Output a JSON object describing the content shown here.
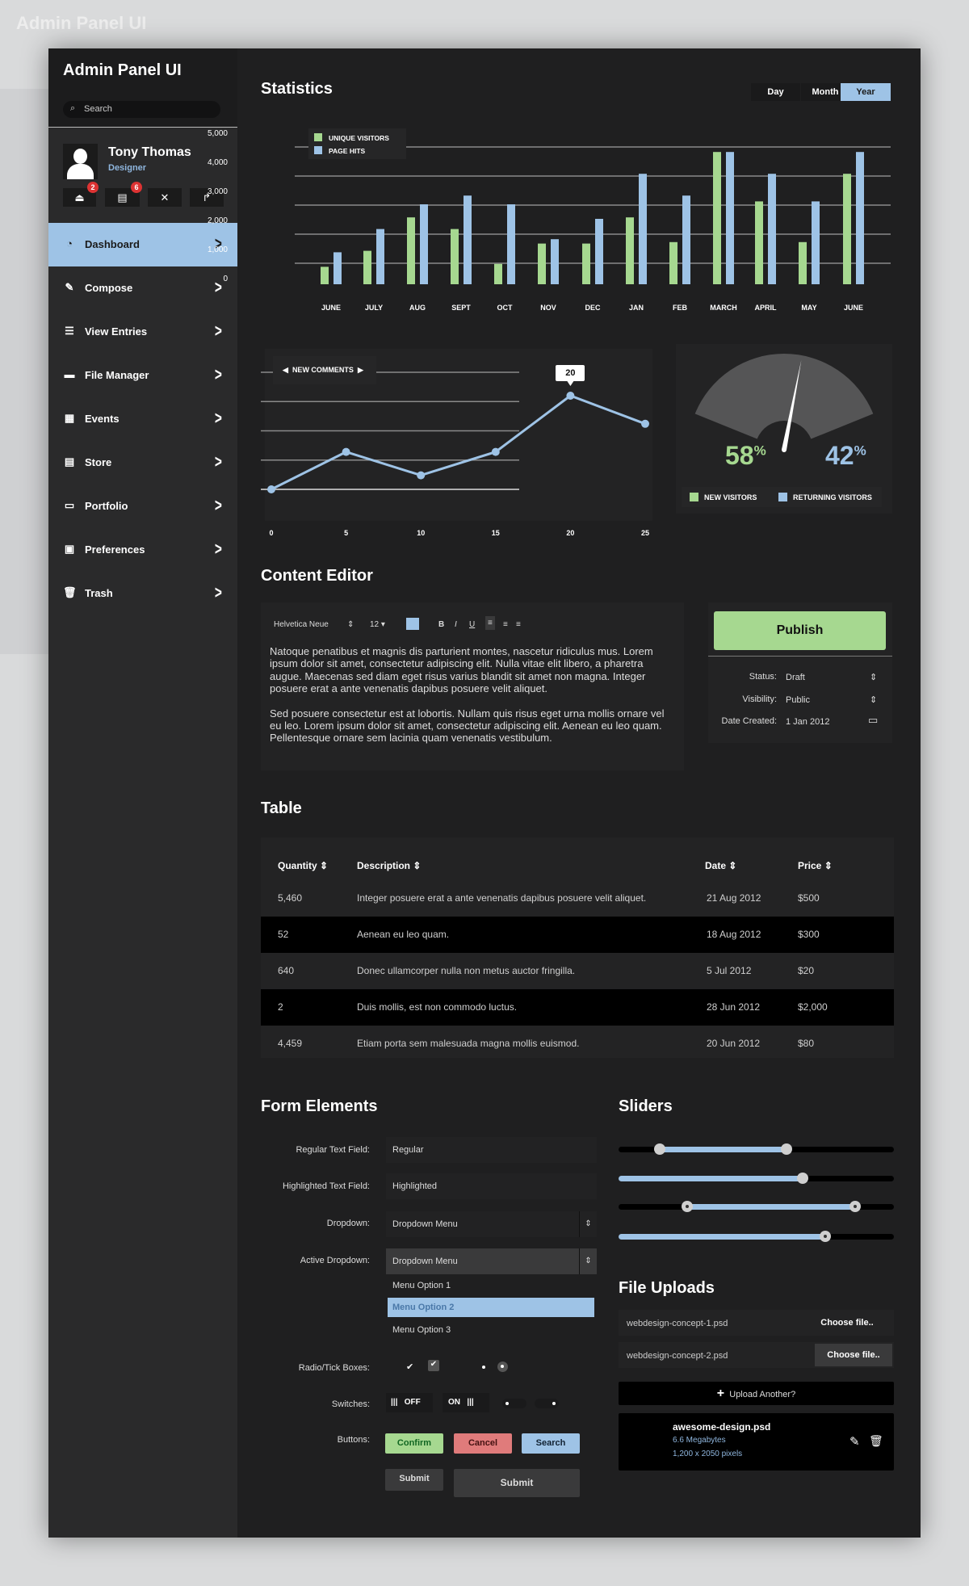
{
  "background_title": "Admin Panel UI",
  "sidebar": {
    "title": "Admin Panel UI",
    "search_placeholder": "Search",
    "user": {
      "name": "Tony Thomas",
      "role": "Designer"
    },
    "quick_buttons": [
      {
        "icon": "inbox-icon",
        "badge": "2"
      },
      {
        "icon": "notes-icon",
        "badge": "6"
      },
      {
        "icon": "tools-icon",
        "badge": ""
      },
      {
        "icon": "logout-icon",
        "badge": ""
      }
    ],
    "items": [
      {
        "label": "Dashboard",
        "icon": "dashboard-icon",
        "glyph": "◔",
        "active": true
      },
      {
        "label": "Compose",
        "icon": "compose-icon",
        "glyph": "✎"
      },
      {
        "label": "View Entries",
        "icon": "list-icon",
        "glyph": "☰"
      },
      {
        "label": "File Manager",
        "icon": "folder-icon",
        "glyph": "▬"
      },
      {
        "label": "Events",
        "icon": "calendar-icon",
        "glyph": "▦"
      },
      {
        "label": "Store",
        "icon": "store-icon",
        "glyph": "▤"
      },
      {
        "label": "Portfolio",
        "icon": "portfolio-icon",
        "glyph": "▭"
      },
      {
        "label": "Preferences",
        "icon": "preferences-icon",
        "glyph": "▣"
      },
      {
        "label": "Trash",
        "icon": "trash-icon",
        "glyph": "🗑"
      }
    ]
  },
  "statistics": {
    "title": "Statistics",
    "ranges": [
      "Day",
      "Month",
      "Year"
    ],
    "active_range": "Year"
  },
  "colors": {
    "green": "#a6d890",
    "blue": "#9ec3e6",
    "red": "#e07b7b"
  },
  "chart_data": [
    {
      "type": "bar",
      "categories": [
        "JUNE",
        "JULY",
        "AUG",
        "SEPT",
        "OCT",
        "NOV",
        "DEC",
        "JAN",
        "FEB",
        "MARCH",
        "APRIL",
        "MAY",
        "JUNE"
      ],
      "series": [
        {
          "name": "UNIQUE VISITORS",
          "color": "#a6d890",
          "values": [
            600,
            1150,
            2300,
            1900,
            700,
            1400,
            1400,
            2300,
            1450,
            4550,
            2850,
            1450,
            3800
          ]
        },
        {
          "name": "PAGE HITS",
          "color": "#9ec3e6",
          "values": [
            1100,
            1900,
            2750,
            3050,
            2750,
            1550,
            2250,
            3800,
            3050,
            4550,
            3800,
            2850,
            4550
          ]
        }
      ],
      "yticks": [
        "0",
        "1,000",
        "2,000",
        "3,000",
        "4,000",
        "5,000"
      ],
      "ylim": [
        0,
        5000
      ],
      "grid": true,
      "legend": "top-left"
    },
    {
      "type": "line",
      "title": "NEW COMMENTS",
      "x": [
        0,
        5,
        10,
        15,
        20,
        25
      ],
      "xticks": [
        "0",
        "5",
        "10",
        "15",
        "20",
        "25"
      ],
      "y": [
        0,
        8,
        3,
        8,
        20,
        14
      ],
      "ylim": [
        0,
        25
      ],
      "tooltip": "20",
      "grid": true
    },
    {
      "type": "gauge",
      "values": [
        58,
        42
      ],
      "labels": [
        "58",
        "42"
      ],
      "unit": "%",
      "series": [
        "NEW VISITORS",
        "RETURNING VISITORS"
      ]
    }
  ],
  "editor": {
    "title": "Content Editor",
    "font": "Helvetica Neue",
    "size": "12 ▾",
    "bold": "B",
    "italic": "I",
    "underline": "U",
    "paragraphs": [
      "Natoque penatibus et magnis dis parturient montes, nascetur ridiculus mus. Lorem ipsum dolor sit amet, consectetur adipiscing elit. Nulla vitae elit libero, a pharetra augue. Maecenas sed diam eget risus varius blandit sit amet non magna. Integer posuere erat a ante venenatis dapibus posuere velit aliquet.",
      "Sed posuere consectetur est at lobortis. Nullam quis risus eget urna mollis ornare vel eu leo. Lorem ipsum dolor sit amet, consectetur adipiscing elit. Aenean eu leo quam. Pellentesque ornare sem lacinia quam venenatis vestibulum."
    ],
    "publish": "Publish",
    "status_label": "Status:",
    "status": "Draft",
    "visibility_label": "Visibility:",
    "visibility": "Public",
    "date_label": "Date Created:",
    "date": "1 Jan 2012"
  },
  "table": {
    "title": "Table",
    "headers": [
      "Quantity",
      "Description",
      "Date",
      "Price"
    ],
    "rows": [
      [
        "5,460",
        "Integer posuere erat a ante venenatis dapibus posuere velit aliquet.",
        "21 Aug 2012",
        "$500"
      ],
      [
        "52",
        "Aenean eu leo quam.",
        "18 Aug 2012",
        "$300"
      ],
      [
        "640",
        "Donec ullamcorper nulla non metus auctor fringilla.",
        "5 Jul 2012",
        "$20"
      ],
      [
        "2",
        "Duis mollis, est non commodo luctus.",
        "28 Jun 2012",
        "$2,000"
      ],
      [
        "4,459",
        "Etiam porta sem malesuada magna mollis euismod.",
        "20 Jun 2012",
        "$80"
      ]
    ]
  },
  "form": {
    "title": "Form Elements",
    "regular_label": "Regular Text Field:",
    "regular_value": "Regular",
    "highlighted_label": "Highlighted Text Field:",
    "highlighted_value": "Highlighted",
    "dropdown_label": "Dropdown:",
    "dropdown_value": "Dropdown Menu",
    "active_dropdown_label": "Active Dropdown:",
    "active_dropdown_value": "Dropdown Menu",
    "options": [
      "Menu Option 1",
      "Menu Option 2",
      "Menu Option 3"
    ],
    "selected_option": "Menu Option 2",
    "radio_label": "Radio/Tick Boxes:",
    "switches_label": "Switches:",
    "off": "OFF",
    "on": "ON",
    "buttons_label": "Buttons:",
    "confirm": "Confirm",
    "cancel": "Cancel",
    "search": "Search",
    "submit_small": "Submit",
    "submit_large": "Submit"
  },
  "sliders": {
    "title": "Sliders",
    "items": [
      {
        "range": [
          0.15,
          0.61
        ]
      },
      {
        "value": 0.67
      },
      {
        "range": [
          0.25,
          0.86
        ]
      },
      {
        "value": 0.75
      }
    ]
  },
  "uploads": {
    "title": "File Uploads",
    "files": [
      "webdesign-concept-1.psd",
      "webdesign-concept-2.psd"
    ],
    "choose": "Choose file..",
    "upload_another": "Upload Another?",
    "card": {
      "name": "awesome-design.psd",
      "size": "6.6 Megabytes",
      "dimensions": "1,200 x 2050 pixels"
    }
  }
}
